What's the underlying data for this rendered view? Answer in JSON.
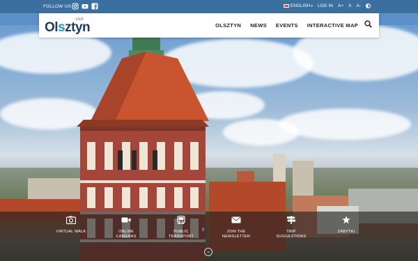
{
  "topbar": {
    "follow_label": "FOLLOW US",
    "social": [
      "instagram-icon",
      "youtube-icon",
      "facebook-icon"
    ],
    "language": "ENGLISH",
    "login": "LOG IN",
    "font_sizes": [
      "A+",
      "A",
      "A-"
    ]
  },
  "logo": {
    "visit": "visit",
    "name_pre": "Ol",
    "name_y": "s",
    "name_post": "ztyn"
  },
  "nav": [
    "OLSZTYN",
    "NEWS",
    "EVENTS",
    "INTERACTIVE MAP"
  ],
  "tiles": [
    {
      "label1": "VIRTUAL WALK",
      "label2": "",
      "icon": "camera-icon"
    },
    {
      "label1": "ONLINE",
      "label2": "CAMERAS",
      "icon": "video-camera-icon"
    },
    {
      "label1": "PUBLIC",
      "label2": "TRANSPORT",
      "icon": "bus-icon"
    },
    {
      "label1": "JOIN THE",
      "label2": "NEWSLETTER",
      "icon": "envelope-icon"
    },
    {
      "label1": "TRIP",
      "label2": "SUGGESTIONS",
      "icon": "signpost-icon"
    },
    {
      "label1": "ZABYTKI",
      "label2": "",
      "icon": "star-icon"
    }
  ],
  "colors": {
    "topbar": "#3a6f9f",
    "logo_dark": "#1f3b59",
    "logo_accent": "#2b8fce"
  }
}
